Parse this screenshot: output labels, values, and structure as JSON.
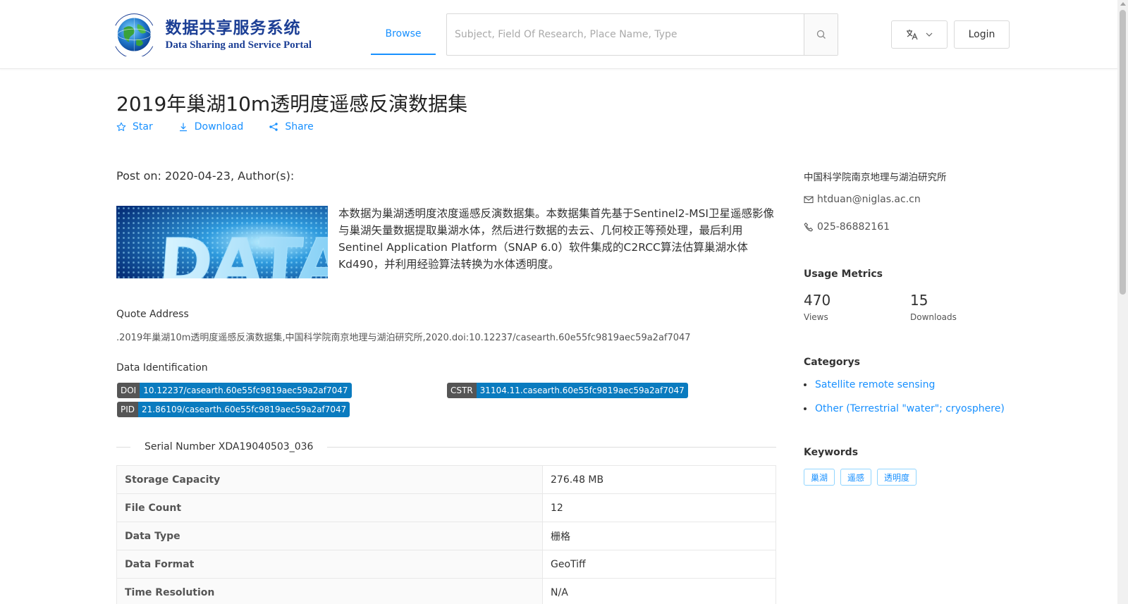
{
  "header": {
    "logo": {
      "cn_title": "数据共享服务系统",
      "en_title": "Data Sharing and Service Portal",
      "ring_text_top": "地球大数据科学数据中心",
      "ring_text_bottom": "Big Earth Data Center, CAS"
    },
    "nav_browse": "Browse",
    "search_placeholder": "Subject, Field Of Research, Place Name, Type",
    "login_label": "Login",
    "lang_icon": "translate-icon"
  },
  "dataset": {
    "title": "2019年巢湖10m透明度遥感反演数据集",
    "actions": {
      "star": "Star",
      "download": "Download",
      "share": "Share"
    },
    "post_on": "Post on: 2020-04-23, Author(s):",
    "image_word": "DATA",
    "description": "本数据为巢湖透明度浓度遥感反演数据集。本数据集首先基于Sentinel2-MSI卫星遥感影像与巢湖矢量数据提取巢湖水体，然后进行数据的去云、几何校正等预处理，最后利用Sentinel Application Platform（SNAP 6.0）软件集成的C2RCC算法估算巢湖水体Kd490，并利用经验算法转换为水体透明度。",
    "quote_label": "Quote Address",
    "quote_text": ".2019年巢湖10m透明度遥感反演数据集,中国科学院南京地理与湖泊研究所,2020.doi:10.12237/casearth.60e55fc9819aec59a2af7047",
    "identification_label": "Data Identification",
    "identifiers": {
      "doi": {
        "key": "DOI",
        "value": "10.12237/casearth.60e55fc9819aec59a2af7047"
      },
      "cstr": {
        "key": "CSTR",
        "value": "31104.11.casearth.60e55fc9819aec59a2af7047"
      },
      "pid": {
        "key": "PID",
        "value": "21.86109/casearth.60e55fc9819aec59a2af7047"
      }
    },
    "serial_number": "Serial Number XDA19040503_036",
    "table": [
      {
        "key": "Storage Capacity",
        "value": "276.48 MB"
      },
      {
        "key": "File Count",
        "value": "12"
      },
      {
        "key": "Data Type",
        "value": "栅格"
      },
      {
        "key": "Data Format",
        "value": "GeoTiff"
      },
      {
        "key": "Time Resolution",
        "value": "N/A"
      }
    ]
  },
  "sidebar": {
    "organization": "中国科学院南京地理与湖泊研究所",
    "email": "htduan@niglas.ac.cn",
    "phone": "025-86882161",
    "usage_title": "Usage Metrics",
    "views_count": "470",
    "views_label": "Views",
    "downloads_count": "15",
    "downloads_label": "Downloads",
    "categories_title": "Categorys",
    "categories": [
      "Satellite remote sensing",
      "Other (Terrestrial \"water\"; cryosphere)"
    ],
    "keywords_title": "Keywords",
    "keywords": [
      "巢湖",
      "遥感",
      "透明度"
    ]
  },
  "colors": {
    "accent": "#1890ff",
    "logo_blue": "#1c3f95",
    "tag_key": "#555555",
    "tag_value": "#0a7bbf"
  }
}
